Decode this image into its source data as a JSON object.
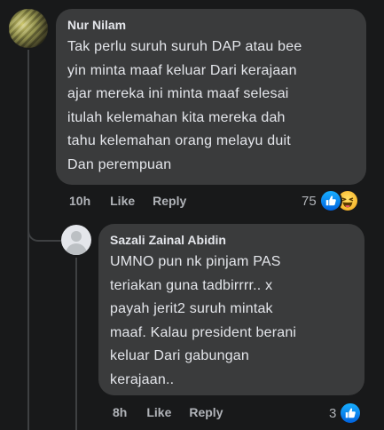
{
  "comments": [
    {
      "author": "Nur Nilam",
      "text_lines": [
        "Tak perlu suruh suruh DAP atau bee",
        "yin minta maaf keluar Dari kerajaan",
        "ajar mereka ini minta maaf selesai",
        "itulah kelemahan kita mereka dah",
        "tahu kelemahan orang melayu duit",
        "Dan perempuan"
      ],
      "time": "10h",
      "like_label": "Like",
      "reply_label": "Reply",
      "reaction_count": "75",
      "reaction_icons": [
        "like-icon",
        "haha-icon"
      ],
      "colors": {
        "like": "#1877f2",
        "haha": "#f7b125"
      }
    },
    {
      "author": "Sazali Zainal Abidin",
      "text_lines": [
        "UMNO pun nk pinjam PAS",
        "teriakan guna tadbirrrr.. x",
        "payah jerit2 suruh mintak",
        "maaf. Kalau president berani",
        "keluar Dari gabungan",
        "kerajaan.."
      ],
      "time": "8h",
      "like_label": "Like",
      "reply_label": "Reply",
      "reaction_count": "3",
      "reaction_icons": [
        "like-icon"
      ]
    }
  ]
}
